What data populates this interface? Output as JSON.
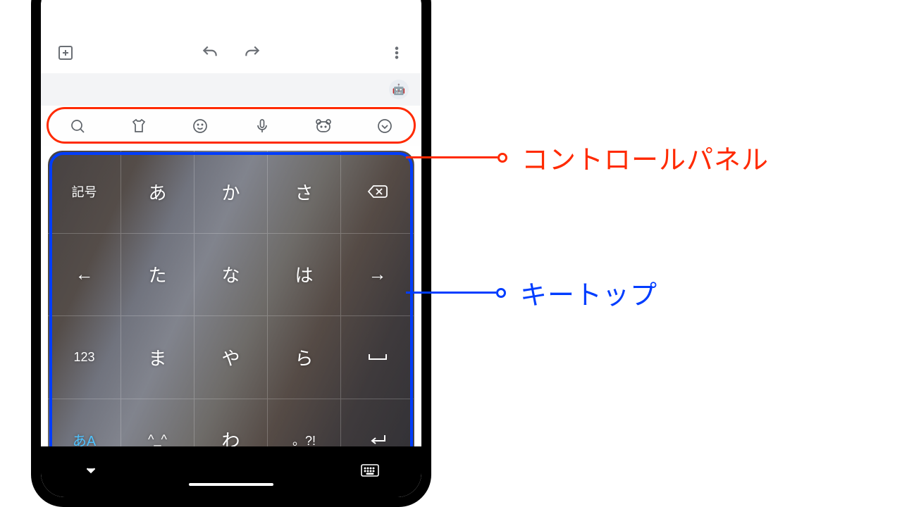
{
  "annotations": {
    "control_panel": "コントロールパネル",
    "key_top": "キートップ"
  },
  "toolbar": {
    "add_icon": "add-box-icon",
    "undo_icon": "undo-icon",
    "redo_icon": "redo-icon",
    "more_icon": "more-vert-icon"
  },
  "assistant_icon": "🤖",
  "control_panel_icons": [
    "search-icon",
    "shirt-icon",
    "emoji-icon",
    "mic-icon",
    "bear-icon",
    "chevron-down-circle-icon"
  ],
  "keys": {
    "rows": [
      [
        {
          "label": "記号",
          "small": true,
          "name": "key-symbols"
        },
        {
          "label": "あ",
          "name": "key-a"
        },
        {
          "label": "か",
          "name": "key-ka"
        },
        {
          "label": "さ",
          "name": "key-sa"
        },
        {
          "label": "⌫",
          "name": "key-backspace"
        }
      ],
      [
        {
          "label": "←",
          "name": "key-left"
        },
        {
          "label": "た",
          "name": "key-ta"
        },
        {
          "label": "な",
          "name": "key-na"
        },
        {
          "label": "は",
          "name": "key-ha"
        },
        {
          "label": "→",
          "name": "key-right"
        }
      ],
      [
        {
          "label": "123",
          "small": true,
          "name": "key-123"
        },
        {
          "label": "ま",
          "name": "key-ma"
        },
        {
          "label": "や",
          "name": "key-ya"
        },
        {
          "label": "ら",
          "name": "key-ra"
        },
        {
          "label": "␣",
          "name": "key-space"
        }
      ],
      [
        {
          "label": "あA",
          "accent": true,
          "name": "key-lang-toggle"
        },
        {
          "label": "^_^",
          "small": true,
          "name": "key-kaomoji"
        },
        {
          "label": "わ",
          "name": "key-wa"
        },
        {
          "label": "。?!",
          "small": true,
          "name": "key-punct"
        },
        {
          "label": "↵",
          "name": "key-enter"
        }
      ]
    ]
  },
  "nav": {
    "collapse_icon": "chevron-down-icon",
    "keyboard_icon": "keyboard-dots-icon"
  }
}
